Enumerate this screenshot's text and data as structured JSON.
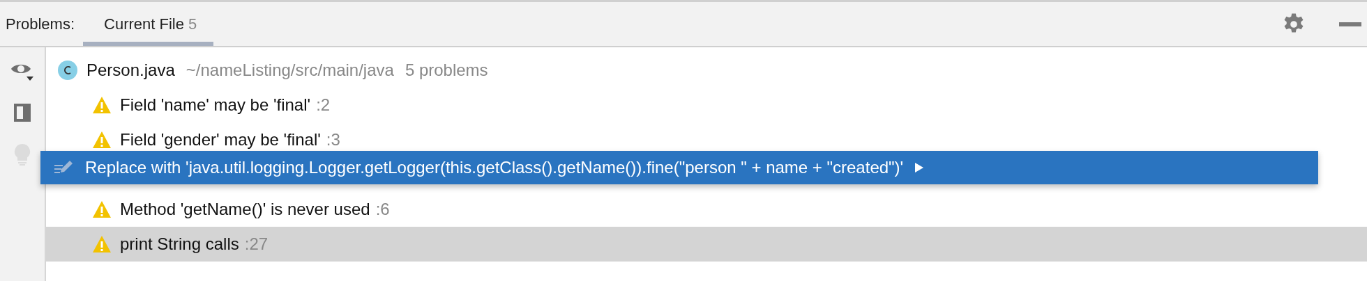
{
  "toolbar": {
    "title": "Problems:",
    "tabs": [
      {
        "label": "Current File",
        "count": "5",
        "selected": true
      }
    ]
  },
  "gutter": {
    "bulb_disabled": true
  },
  "file": {
    "name": "Person.java",
    "path": "~/nameListing/src/main/java",
    "summary": "5 problems"
  },
  "problems": [
    {
      "text": "Field 'name' may be 'final'",
      "line": ":2",
      "selected": false
    },
    {
      "text": "Field 'gender' may be 'final'",
      "line": ":3",
      "selected": false
    },
    {
      "kind": "popup",
      "text": "Replace with 'java.util.logging.Logger.getLogger(this.getClass().getName()).fine(\"person \" + name + \"created\")'"
    },
    {
      "text": "Method 'getName()' is never used",
      "line": ":6",
      "selected": false
    },
    {
      "text": "print String calls",
      "line": ":27",
      "selected": true
    }
  ]
}
